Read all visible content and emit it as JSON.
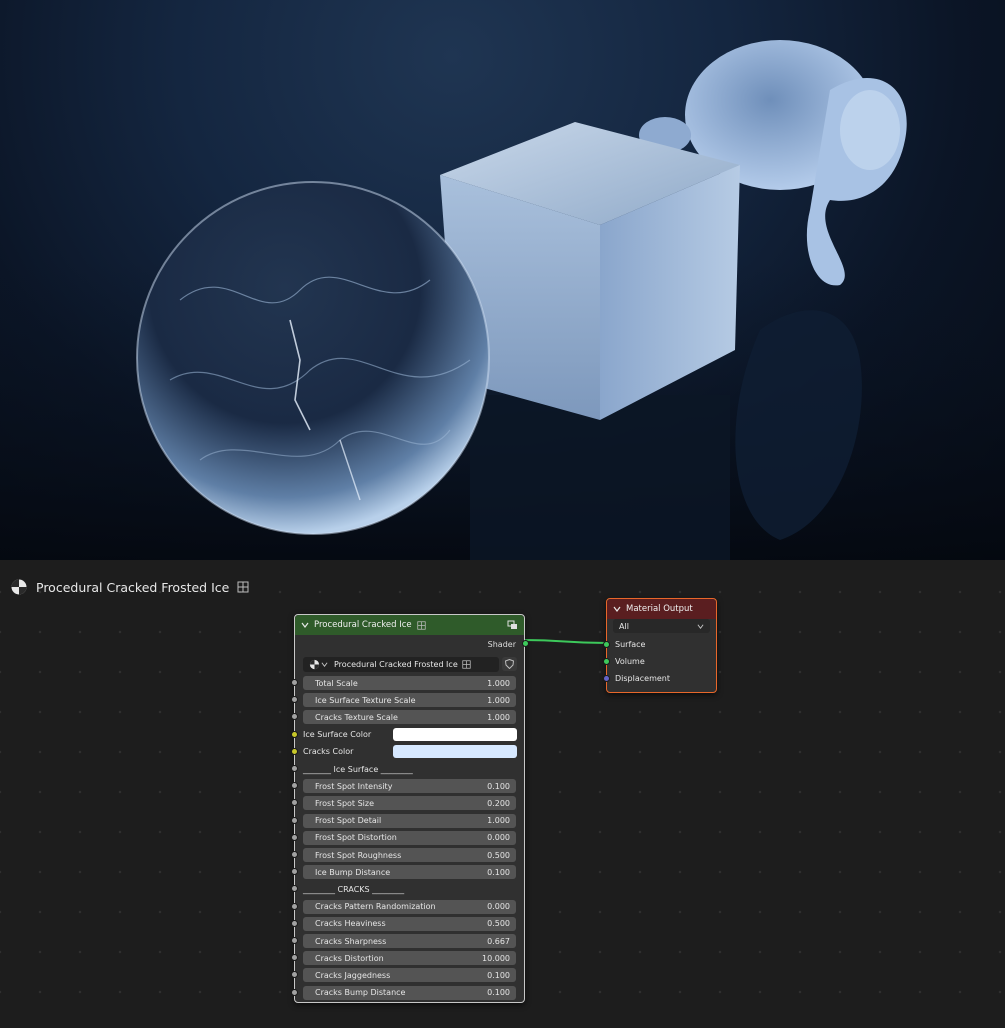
{
  "material": {
    "name": "Procedural Cracked Frosted Ice",
    "icon": "material-sphere-icon",
    "fake_user_icon": "node-tree-icon"
  },
  "group_node": {
    "title": "Procedural Cracked Ice",
    "collapse_icon": "chevron-down-icon",
    "output_label": "Shader",
    "datablock_name": "Procedural Cracked Frosted Ice",
    "inputs": [
      {
        "label": "Total Scale",
        "value": "1.000"
      },
      {
        "label": "Ice Surface Texture Scale",
        "value": "1.000"
      },
      {
        "label": "Cracks Texture Scale",
        "value": "1.000"
      }
    ],
    "ice_surface_color_label": "Ice Surface Color",
    "cracks_color_label": "Cracks Color",
    "ice_surface_color": "#ffffff",
    "cracks_color": "#d6e8ff",
    "ice_surface_separator": "_______ Ice Surface ________",
    "ice_surface_inputs": [
      {
        "label": "Frost Spot Intensity",
        "value": "0.100"
      },
      {
        "label": "Frost Spot Size",
        "value": "0.200"
      },
      {
        "label": "Frost Spot Detail",
        "value": "1.000"
      },
      {
        "label": "Frost Spot Distortion",
        "value": "0.000"
      },
      {
        "label": "Frost Spot Roughness",
        "value": "0.500"
      },
      {
        "label": "Ice Bump Distance",
        "value": "0.100"
      }
    ],
    "cracks_separator": "________ CRACKS ________",
    "cracks_inputs": [
      {
        "label": "Cracks Pattern Randomization",
        "value": "0.000"
      },
      {
        "label": "Cracks Heaviness",
        "value": "0.500"
      },
      {
        "label": "Cracks Sharpness",
        "value": "0.667"
      },
      {
        "label": "Cracks Distortion",
        "value": "10.000"
      },
      {
        "label": "Cracks Jaggedness",
        "value": "0.100"
      },
      {
        "label": "Cracks Bump Distance",
        "value": "0.100"
      }
    ]
  },
  "output_node": {
    "title": "Material Output",
    "target": "All",
    "inputs": [
      "Surface",
      "Volume",
      "Displacement"
    ]
  },
  "colors": {
    "group_header": "#2f5b2a",
    "output_header": "#5a1e20",
    "output_border": "#e8672a",
    "shader_socket": "#3dc95b",
    "color_socket": "#c7c729",
    "float_socket": "#a1a1a1",
    "vector_socket": "#6363c7"
  }
}
